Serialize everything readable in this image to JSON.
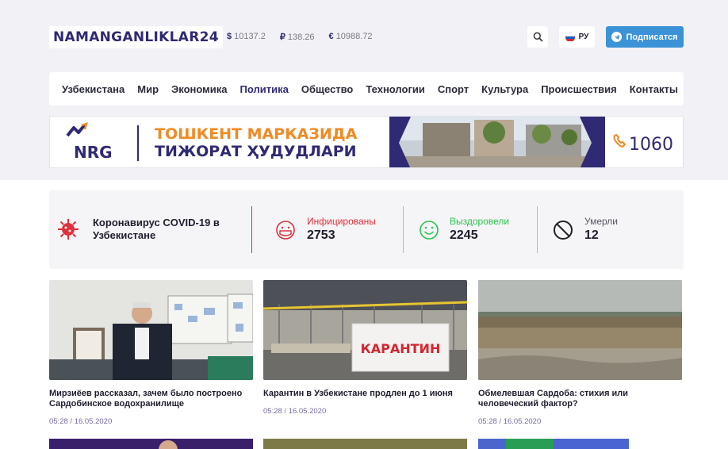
{
  "header": {
    "logo": "NAMANGANLIKLAR24",
    "rates": [
      {
        "symbol": "$",
        "value": "10137.2"
      },
      {
        "symbol": "₽",
        "value": "138.26"
      },
      {
        "symbol": "€",
        "value": "10988.72"
      }
    ],
    "lang_label": "РУ",
    "subscribe_label": "Подписатся"
  },
  "nav": {
    "items": [
      "Узбекистана",
      "Мир",
      "Экономика",
      "Политика",
      "Общество",
      "Технологии",
      "Спорт",
      "Культура",
      "Происшествия",
      "Контакты"
    ],
    "active_index": 3
  },
  "banner": {
    "brand": "NRG",
    "line1": "ТОШКЕНТ МАРКАЗИДА",
    "line2": "ТИЖОРАТ ҲУДУДЛАРИ",
    "phone": "1060"
  },
  "covid": {
    "title": "Коронавирус COVID-19 в Узбекистане",
    "stats": [
      {
        "label": "Инфицированы",
        "value": "2753",
        "color": "#e0303b"
      },
      {
        "label": "Выздоровели",
        "value": "2245",
        "color": "#2bc24a"
      },
      {
        "label": "Умерли",
        "value": "12",
        "color": "#555560"
      }
    ]
  },
  "news": [
    {
      "title": "Мирзиёев рассказал, зачем было построено Сардобинское водохранилище",
      "date": "05:28 / 16.05.2020"
    },
    {
      "title": "Карантин в Узбекистане продлен до 1 июня",
      "date": "05:28 / 16.05.2020",
      "sign_text": "КАРАНТИН"
    },
    {
      "title": "Обмелевшая Сардоба: стихия или человеческий фактор?",
      "date": "05:28 / 16.05.2020"
    }
  ],
  "colors": {
    "brand": "#2f2a73",
    "accent_blue": "#3c92d6",
    "band_bg": "#f1f1f6",
    "banner_orange": "#f08a24"
  }
}
